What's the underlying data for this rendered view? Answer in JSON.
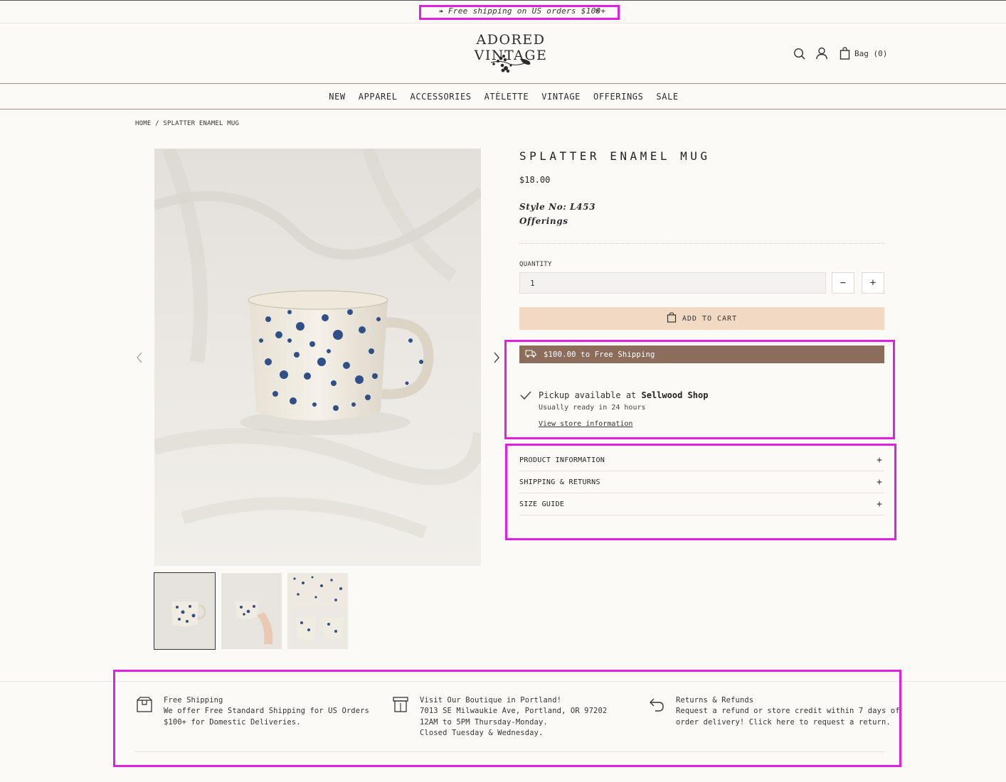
{
  "announcement": {
    "text": "❧ Free shipping on US orders $100+",
    "close_symbol": "×"
  },
  "header": {
    "logo_text": "ADORED VINTAGE",
    "bag_label": "Bag (0)"
  },
  "nav": {
    "items": [
      "NEW",
      "APPAREL",
      "ACCESSORIES",
      "ATÈLETTE",
      "VINTAGE",
      "OFFERINGS",
      "SALE"
    ]
  },
  "breadcrumb": "HOME / SPLATTER ENAMEL MUG",
  "product": {
    "title": "SPLATTER ENAMEL MUG",
    "price": "$18.00",
    "style_no": "Style No: L453",
    "collection": "Offerings",
    "quantity_label": "QUANTITY",
    "quantity_value": "1",
    "minus_symbol": "−",
    "plus_symbol": "+",
    "add_to_cart_label": "ADD TO CART",
    "free_shipping_text": "$100.00 to Free Shipping"
  },
  "pickup": {
    "prefix": "Pickup available at ",
    "store": "Sellwood Shop",
    "ready_text": "Usually ready in 24 hours",
    "link_text": "View store information"
  },
  "accordion": {
    "items": [
      {
        "label": "PRODUCT INFORMATION",
        "icon": "+"
      },
      {
        "label": "SHIPPING & RETURNS",
        "icon": "+"
      },
      {
        "label": "SIZE GUIDE",
        "icon": "+"
      }
    ]
  },
  "features": [
    {
      "icon": "box-icon",
      "lines": [
        "Free Shipping",
        "We offer Free Standard Shipping for US Orders",
        "$100+ for Domestic Deliveries."
      ]
    },
    {
      "icon": "storefront-icon",
      "lines": [
        "Visit Our Boutique in Portland!",
        "7013 SE Milwaukie Ave, Portland, OR 97202",
        "12AM to 5PM Thursday-Monday.",
        "Closed Tuesday & Wednesday."
      ]
    },
    {
      "icon": "return-arrow-icon",
      "lines": [
        "Returns & Refunds",
        "Request a refund or store credit within 7 days of",
        "order delivery! Click here to request a return."
      ]
    }
  ],
  "colors": {
    "background": "#fcfaf7",
    "add_to_cart_bg": "#f2d9c3",
    "shipping_bar_bg": "#8c6d5c",
    "rule": "#a98f7d",
    "highlight": "#e020e0"
  }
}
